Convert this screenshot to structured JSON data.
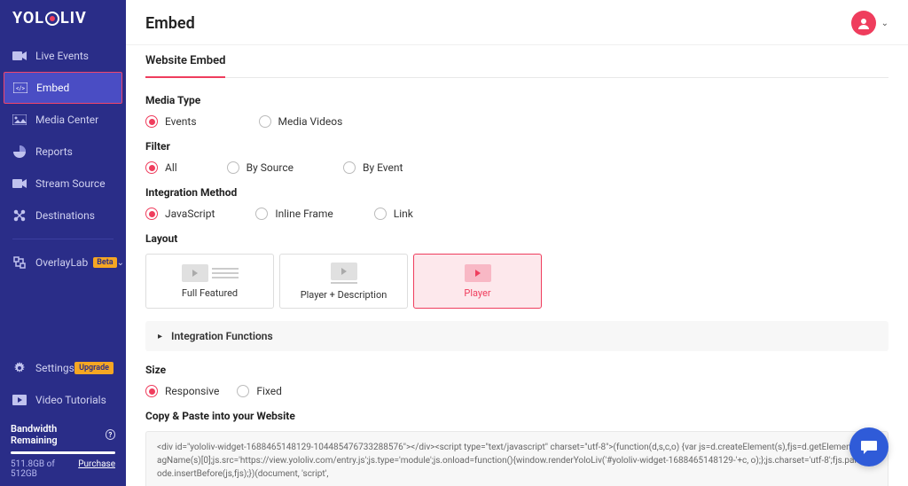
{
  "logo": "YOLOLIV",
  "nav": {
    "items": [
      {
        "label": "Live Events"
      },
      {
        "label": "Embed"
      },
      {
        "label": "Media Center"
      },
      {
        "label": "Reports"
      },
      {
        "label": "Stream Source"
      },
      {
        "label": "Destinations"
      },
      {
        "label": "OverlayLab",
        "beta": "Beta"
      }
    ],
    "bottom": [
      {
        "label": "Settings",
        "upgrade": "Upgrade"
      },
      {
        "label": "Video Tutorials"
      }
    ]
  },
  "bandwidth": {
    "title": "Bandwidth Remaining",
    "used": "511.8GB of 512GB",
    "purchase": "Purchase"
  },
  "header": {
    "title": "Embed"
  },
  "tabs": {
    "website_embed": "Website Embed"
  },
  "form": {
    "media_type": {
      "label": "Media Type",
      "opt1": "Events",
      "opt2": "Media Videos"
    },
    "filter": {
      "label": "Filter",
      "opt1": "All",
      "opt2": "By Source",
      "opt3": "By Event"
    },
    "integration": {
      "label": "Integration Method",
      "opt1": "JavaScript",
      "opt2": "Inline Frame",
      "opt3": "Link"
    },
    "layout": {
      "label": "Layout",
      "opt1": "Full Featured",
      "opt2": "Player + Description",
      "opt3": "Player"
    },
    "accordion": "Integration Functions",
    "size": {
      "label": "Size",
      "opt1": "Responsive",
      "opt2": "Fixed"
    },
    "copy": {
      "label": "Copy & Paste into your Website"
    },
    "code": "<div id=\"yololiv-widget-1688465148129-104485476733288576\"></div><script type=\"text/javascript\" charset=\"utf-8\">(function(d,s,c,o) {var js=d.createElement(s),fjs=d.getElementsByTagName(s)[0];js.src='https://view.yololiv.com/entry.js';js.type='module';js.onload=function(){window.renderYoloLiv('#yololiv-widget-1688465148129-'+c, o);};js.charset='utf-8';fjs.parentNode.insertBefore(js,fjs);})(document, 'script',"
  }
}
